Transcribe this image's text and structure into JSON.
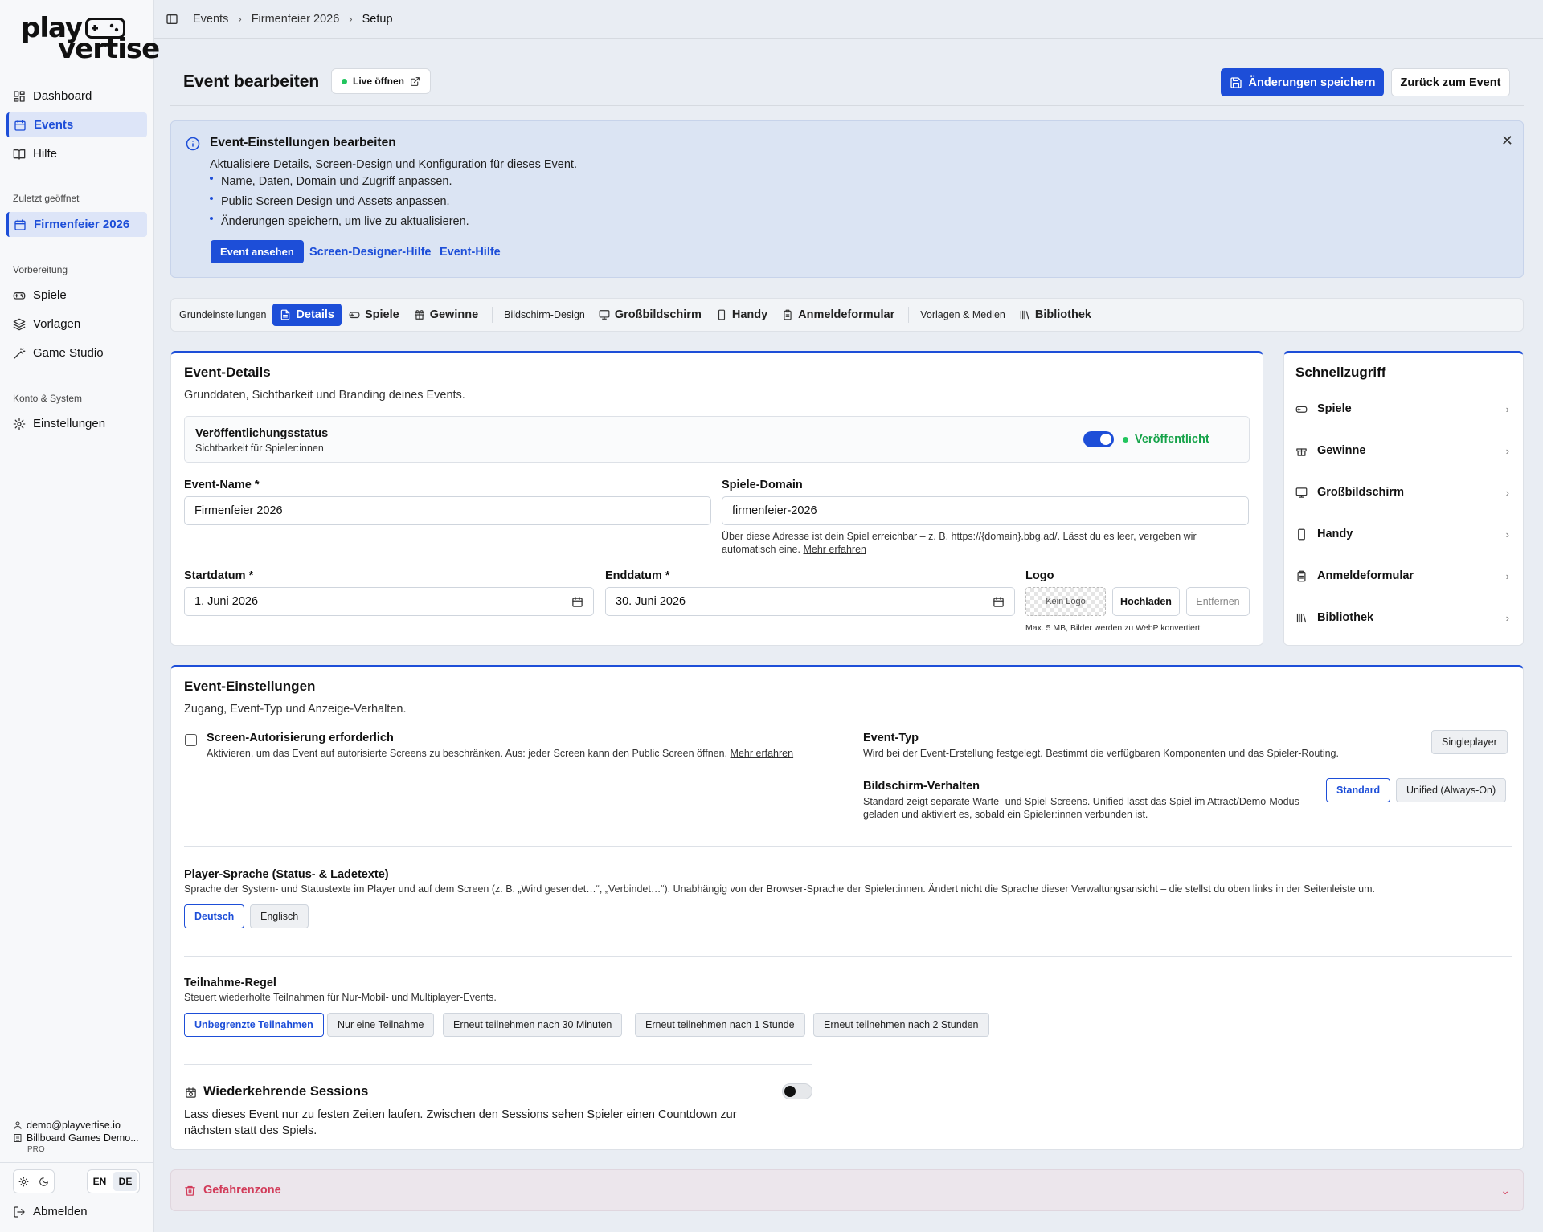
{
  "sidebar": {
    "logo": {
      "line1": "play",
      "line2": "vertise"
    },
    "nav": [
      {
        "label": "Dashboard",
        "icon": "dashboard-icon"
      },
      {
        "label": "Events",
        "icon": "calendar-icon"
      },
      {
        "label": "Hilfe",
        "icon": "book-icon"
      }
    ],
    "recent_heading": "Zuletzt geöffnet",
    "recent_item": "Firmenfeier 2026",
    "prep_heading": "Vorbereitung",
    "prep": [
      {
        "label": "Spiele",
        "icon": "gamepad-icon"
      },
      {
        "label": "Vorlagen",
        "icon": "layers-icon"
      },
      {
        "label": "Game Studio",
        "icon": "wand-icon"
      }
    ],
    "system_heading": "Konto & System",
    "system": [
      {
        "label": "Einstellungen",
        "icon": "gear-icon"
      }
    ],
    "account_email": "demo@playvertise.io",
    "account_org": "Billboard Games Demo...",
    "account_plan": "PRO",
    "lang_en": "EN",
    "lang_de": "DE",
    "logout": "Abmelden"
  },
  "breadcrumb": [
    "Events",
    "Firmenfeier 2026",
    "Setup"
  ],
  "header": {
    "title": "Event bearbeiten",
    "live_button": "Live öffnen",
    "save_button": "Änderungen speichern",
    "back_button": "Zurück zum Event"
  },
  "info": {
    "title": "Event-Einstellungen bearbeiten",
    "desc": "Aktualisiere Details, Screen-Design und Konfiguration für dieses Event.",
    "bullets": [
      "Name, Daten, Domain und Zugriff anpassen.",
      "Public Screen Design und Assets anpassen.",
      "Änderungen speichern, um live zu aktualisieren."
    ],
    "view_button": "Event ansehen",
    "link1": "Screen-Designer-Hilfe",
    "link2": "Event-Hilfe"
  },
  "tabs": {
    "group1": "Grundeinstellungen",
    "details": "Details",
    "spiele": "Spiele",
    "gewinne": "Gewinne",
    "group2": "Bildschirm-Design",
    "gross": "Großbildschirm",
    "handy": "Handy",
    "anmelde": "Anmeldeformular",
    "group3": "Vorlagen & Medien",
    "bibliothek": "Bibliothek"
  },
  "details": {
    "title": "Event-Details",
    "sub": "Grunddaten, Sichtbarkeit und Branding deines Events.",
    "pub_title": "Veröffentlichungsstatus",
    "pub_sub": "Sichtbarkeit für Spieler:innen",
    "pub_status": "Veröffentlicht",
    "name_label": "Event-Name *",
    "name_value": "Firmenfeier 2026",
    "domain_label": "Spiele-Domain",
    "domain_value": "firmenfeier-2026",
    "domain_help": "Über diese Adresse ist dein Spiel erreichbar – z. B. https://{domain}.bbg.ad/. Lässt du es leer, vergeben wir automatisch eine.",
    "domain_help_link": "Mehr erfahren",
    "start_label": "Startdatum *",
    "start_value": "1. Juni 2026",
    "end_label": "Enddatum *",
    "end_value": "30. Juni 2026",
    "logo_label": "Logo",
    "logo_placeholder": "Kein Logo",
    "upload": "Hochladen",
    "remove": "Entfernen",
    "logo_help": "Max. 5 MB, Bilder werden zu WebP konvertiert"
  },
  "quick": {
    "title": "Schnellzugriff",
    "items": [
      {
        "label": "Spiele",
        "icon": "gamepad-icon"
      },
      {
        "label": "Gewinne",
        "icon": "gift-icon"
      },
      {
        "label": "Großbildschirm",
        "icon": "monitor-icon"
      },
      {
        "label": "Handy",
        "icon": "phone-icon"
      },
      {
        "label": "Anmeldeformular",
        "icon": "clipboard-icon"
      },
      {
        "label": "Bibliothek",
        "icon": "library-icon"
      }
    ]
  },
  "settings": {
    "title": "Event-Einstellungen",
    "sub": "Zugang, Event-Typ und Anzeige-Verhalten.",
    "auth_title": "Screen-Autorisierung erforderlich",
    "auth_desc": "Aktivieren, um das Event auf autorisierte Screens zu beschränken. Aus: jeder Screen kann den Public Screen öffnen.",
    "auth_link": "Mehr erfahren",
    "type_title": "Event-Typ",
    "type_desc": "Wird bei der Event-Erstellung festgelegt. Bestimmt die verfügbaren Komponenten und das Spieler-Routing.",
    "type_value": "Singleplayer",
    "behav_title": "Bildschirm-Verhalten",
    "behav_desc": "Standard zeigt separate Warte- und Spiel-Screens. Unified lässt das Spiel im Attract/Demo-Modus geladen und aktiviert es, sobald ein Spieler:innen verbunden ist.",
    "behav_opt1": "Standard",
    "behav_opt2": "Unified (Always-On)",
    "lang_title": "Player-Sprache (Status- & Ladetexte)",
    "lang_desc": "Sprache der System- und Statustexte im Player und auf dem Screen (z. B. „Wird gesendet…“, „Verbindet…“). Unabhängig von der Browser-Sprache der Spieler:innen. Ändert nicht die Sprache dieser Verwaltungsansicht – die stellst du oben links in der Seitenleiste um.",
    "lang_opt1": "Deutsch",
    "lang_opt2": "Englisch",
    "part_title": "Teilnahme-Regel",
    "part_desc": "Steuert wiederholte Teilnahmen für Nur-Mobil- und Multiplayer-Events.",
    "part_opts": [
      "Unbegrenzte Teilnahmen",
      "Nur eine Teilnahme",
      "Erneut teilnehmen nach 30 Minuten",
      "Erneut teilnehmen nach 1 Stunde",
      "Erneut teilnehmen nach 2 Stunden"
    ],
    "sessions_title": "Wiederkehrende Sessions",
    "sessions_desc": "Lass dieses Event nur zu festen Zeiten laufen. Zwischen den Sessions sehen Spieler einen Countdown zur nächsten statt des Spiels."
  },
  "danger": {
    "title": "Gefahrenzone"
  },
  "colors": {
    "accent": "#1d4ed8",
    "success": "#16a34a",
    "danger": "#d23c5a",
    "banner": "#dbe4f3"
  }
}
